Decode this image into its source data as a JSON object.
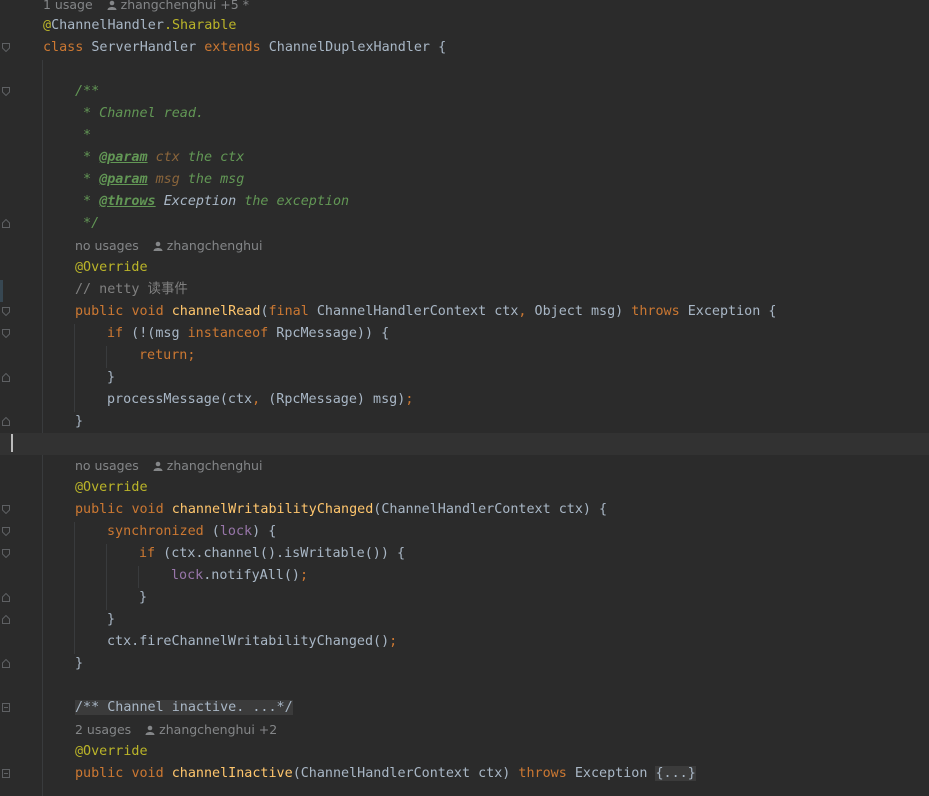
{
  "header_hint": {
    "usages": "1 usage",
    "author": "zhangchenghui +5 *"
  },
  "class_decl": {
    "annotation_at": "@",
    "annotation_name": "ChannelHandler",
    "annotation_member": "Sharable",
    "kw_class": "class",
    "class_name": "ServerHandler",
    "kw_extends": "extends",
    "parent": "ChannelDuplexHandler",
    "brace": "{"
  },
  "javadoc_read": {
    "open": "/**",
    "summary": " * Channel read.",
    "blank": " *",
    "param1_prefix": " * ",
    "param1_tag": "@param",
    "param1_name": "ctx",
    "param1_desc": "the ctx",
    "param2_tag": "@param",
    "param2_name": "msg",
    "param2_desc": "the msg",
    "throws_tag": "@throws",
    "throws_type": "Exception",
    "throws_desc": "the exception",
    "close": " */"
  },
  "channel_read": {
    "hint_usages": "no usages",
    "hint_author": "zhangchenghui",
    "annotation": "@Override",
    "comment": "// netty 读事件",
    "sig_public": "public",
    "sig_void": "void",
    "sig_name": "channelRead",
    "sig_open": "(",
    "sig_final": "final",
    "sig_type1": "ChannelHandlerContext ctx",
    "sig_comma": ",",
    "sig_type2": " Object msg)",
    "sig_throws": "throws",
    "sig_exc": "Exception {",
    "if_kw": "if",
    "if_cond_a": " (!(msg ",
    "if_instanceof": "instanceof",
    "if_cond_b": " RpcMessage)) {",
    "return_kw": "return",
    "semi": ";",
    "close_inner": "}",
    "process_a": "processMessage(ctx",
    "process_comma": ",",
    "process_b": " (RpcMessage) msg)",
    "process_semi": ";",
    "close": "}"
  },
  "writability": {
    "hint_usages": "no usages",
    "hint_author": "zhangchenghui",
    "annotation": "@Override",
    "sig_public": "public",
    "sig_void": "void",
    "sig_name": "channelWritabilityChanged",
    "sig_rest": "(ChannelHandlerContext ctx) {",
    "sync_kw": "synchronized",
    "sync_open": " (",
    "lock": "lock",
    "sync_close": ") {",
    "if_kw": "if",
    "if_cond": " (ctx.channel().isWritable()) {",
    "notify_lock": "lock",
    "notify_call": ".notifyAll()",
    "notify_semi": ";",
    "close_if": "}",
    "close_sync": "}",
    "fire_call": "ctx.fireChannelWritabilityChanged()",
    "fire_semi": ";",
    "close": "}"
  },
  "inactive": {
    "collapsed_doc": "/** Channel inactive. ...*/",
    "hint_usages": "2 usages",
    "hint_author": "zhangchenghui +2",
    "annotation": "@Override",
    "sig_public": "public",
    "sig_void": "void",
    "sig_name": "channelInactive",
    "sig_params": "(ChannelHandlerContext ctx) ",
    "sig_throws": "throws",
    "sig_exc": " Exception ",
    "collapsed_body": "{...}"
  }
}
